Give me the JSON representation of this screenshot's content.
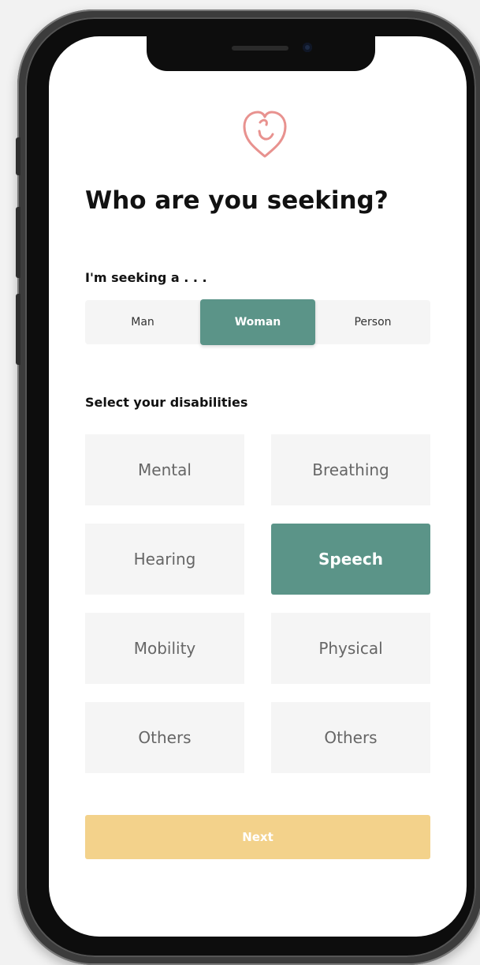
{
  "header": {
    "title": "Who are you seeking?"
  },
  "seeking": {
    "label": "I'm seeking a . . .",
    "options": [
      "Man",
      "Woman",
      "Person"
    ],
    "selected": "Woman"
  },
  "disabilities": {
    "label": "Select your disabilities",
    "items": [
      "Mental",
      "Breathing",
      "Hearing",
      "Speech",
      "Mobility",
      "Physical",
      "Others",
      "Others"
    ],
    "selected": [
      "Speech"
    ]
  },
  "footer": {
    "next_label": "Next"
  },
  "icons": {
    "logo": "heart-smile-icon"
  },
  "colors": {
    "accent": "#5b9488",
    "next_button": "#f3d28b",
    "logo": "#e8928f"
  }
}
